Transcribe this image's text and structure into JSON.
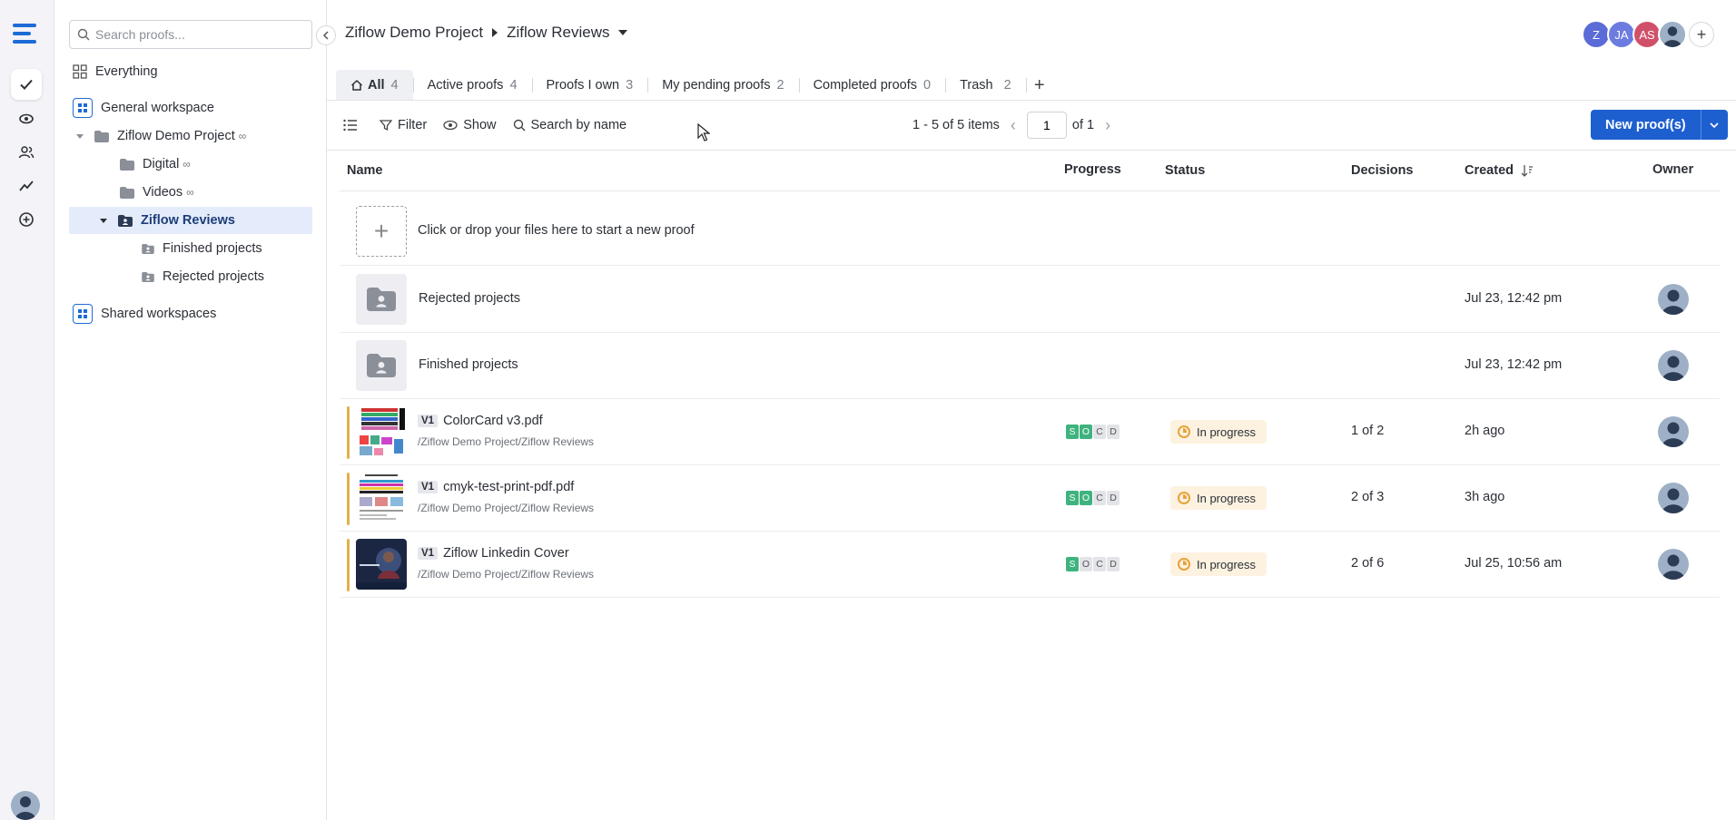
{
  "rail": {
    "items": [
      "check-icon",
      "eye-icon",
      "users-icon",
      "chart-icon",
      "add-circle-icon"
    ]
  },
  "sidebar": {
    "search_placeholder": "Search proofs...",
    "everything": "Everything",
    "general_workspace": "General workspace",
    "project": "Ziflow Demo Project",
    "digital": "Digital",
    "videos": "Videos",
    "ziflow_reviews": "Ziflow Reviews",
    "finished_projects": "Finished projects",
    "rejected_projects": "Rejected projects",
    "shared_workspaces": "Shared workspaces"
  },
  "header": {
    "crumb_project": "Ziflow Demo Project",
    "crumb_folder": "Ziflow Reviews",
    "avatars": [
      {
        "initials": "Z",
        "color": "#5b6bd8"
      },
      {
        "initials": "JA",
        "color": "#6b7be0"
      },
      {
        "initials": "AS",
        "color": "#d0506a"
      }
    ]
  },
  "tabs": [
    {
      "label": "All",
      "count": "4"
    },
    {
      "label": "Active proofs",
      "count": "4"
    },
    {
      "label": "Proofs I own",
      "count": "3"
    },
    {
      "label": "My pending proofs",
      "count": "2"
    },
    {
      "label": "Completed proofs",
      "count": "0"
    },
    {
      "label": "Trash",
      "count": "2"
    }
  ],
  "toolbar": {
    "filter": "Filter",
    "show": "Show",
    "search_by_name": "Search by name",
    "items_range": "1 - 5 of 5 items",
    "page_value": "1",
    "page_of": "of 1",
    "new_proof": "New proof(s)"
  },
  "columns": {
    "name": "Name",
    "progress": "Progress",
    "status": "Status",
    "decisions": "Decisions",
    "created": "Created",
    "owner": "Owner"
  },
  "upload_text": "Click or drop your files here to start a new proof",
  "folders": [
    {
      "name": "Rejected projects",
      "created": "Jul 23, 12:42 pm"
    },
    {
      "name": "Finished projects",
      "created": "Jul 23, 12:42 pm"
    }
  ],
  "proofs": [
    {
      "version": "V1",
      "name": "ColorCard v3.pdf",
      "path": "/Ziflow Demo Project/Ziflow Reviews",
      "progress": [
        "S",
        "O",
        "C",
        "D"
      ],
      "progress_done": 2,
      "status": "In progress",
      "decisions": "1 of 2",
      "created": "2h ago"
    },
    {
      "version": "V1",
      "name": "cmyk-test-print-pdf.pdf",
      "path": "/Ziflow Demo Project/Ziflow Reviews",
      "progress": [
        "S",
        "O",
        "C",
        "D"
      ],
      "progress_done": 2,
      "status": "In progress",
      "decisions": "2 of 3",
      "created": "3h ago"
    },
    {
      "version": "V1",
      "name": "Ziflow Linkedin Cover",
      "path": "/Ziflow Demo Project/Ziflow Reviews",
      "progress": [
        "S",
        "O",
        "C",
        "D"
      ],
      "progress_done": 1,
      "status": "In progress",
      "decisions": "2 of 6",
      "created": "Jul 25, 10:56 am"
    }
  ]
}
